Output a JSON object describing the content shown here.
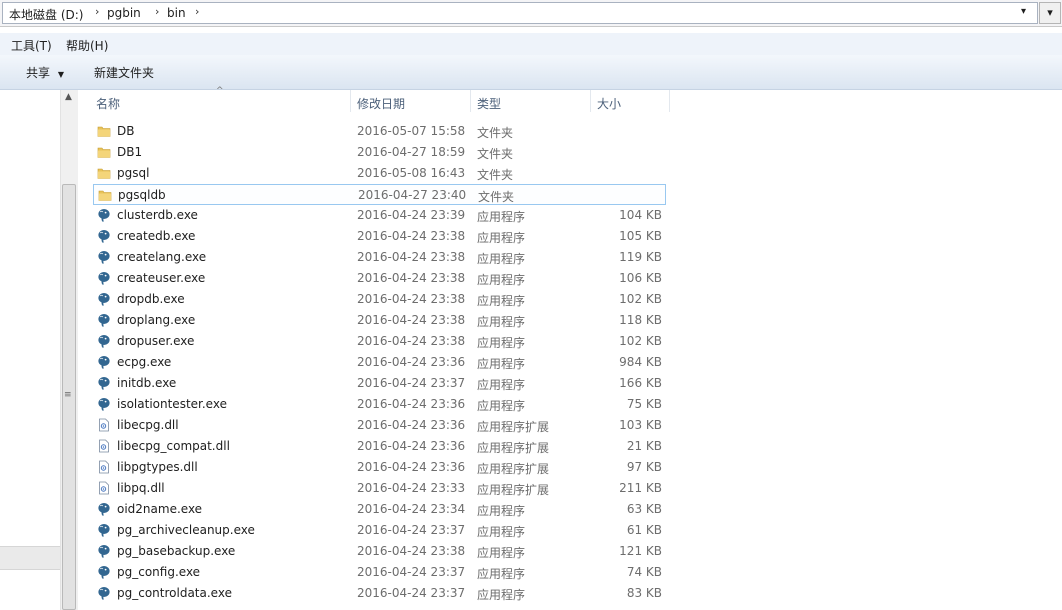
{
  "address": {
    "crumbs": [
      "本地磁盘 (D:)",
      "pgbin",
      "bin"
    ],
    "separator": "›",
    "dropdown": "▾",
    "refresh": "▾"
  },
  "menu": {
    "items": [
      "工具(T)",
      "帮助(H)"
    ]
  },
  "toolbar": {
    "share_label": "共享",
    "share_arrow": "▼",
    "new_folder_label": "新建文件夹"
  },
  "columns": {
    "name": "名称",
    "date": "修改日期",
    "type": "类型",
    "size": "大小"
  },
  "files": [
    {
      "name": "DB",
      "date": "2016-05-07 15:58",
      "type": "文件夹",
      "size": "",
      "icon": "folder-icon"
    },
    {
      "name": "DB1",
      "date": "2016-04-27 18:59",
      "type": "文件夹",
      "size": "",
      "icon": "folder-icon"
    },
    {
      "name": "pgsql",
      "date": "2016-05-08 16:43",
      "type": "文件夹",
      "size": "",
      "icon": "folder-icon"
    },
    {
      "name": "pgsqldb",
      "date": "2016-04-27 23:40",
      "type": "文件夹",
      "size": "",
      "icon": "folder-icon",
      "selected": true
    },
    {
      "name": "clusterdb.exe",
      "date": "2016-04-24 23:39",
      "type": "应用程序",
      "size": "104 KB",
      "icon": "postgresql-elephant-icon"
    },
    {
      "name": "createdb.exe",
      "date": "2016-04-24 23:38",
      "type": "应用程序",
      "size": "105 KB",
      "icon": "postgresql-elephant-icon"
    },
    {
      "name": "createlang.exe",
      "date": "2016-04-24 23:38",
      "type": "应用程序",
      "size": "119 KB",
      "icon": "postgresql-elephant-icon"
    },
    {
      "name": "createuser.exe",
      "date": "2016-04-24 23:38",
      "type": "应用程序",
      "size": "106 KB",
      "icon": "postgresql-elephant-icon"
    },
    {
      "name": "dropdb.exe",
      "date": "2016-04-24 23:38",
      "type": "应用程序",
      "size": "102 KB",
      "icon": "postgresql-elephant-icon"
    },
    {
      "name": "droplang.exe",
      "date": "2016-04-24 23:38",
      "type": "应用程序",
      "size": "118 KB",
      "icon": "postgresql-elephant-icon"
    },
    {
      "name": "dropuser.exe",
      "date": "2016-04-24 23:38",
      "type": "应用程序",
      "size": "102 KB",
      "icon": "postgresql-elephant-icon"
    },
    {
      "name": "ecpg.exe",
      "date": "2016-04-24 23:36",
      "type": "应用程序",
      "size": "984 KB",
      "icon": "postgresql-elephant-icon"
    },
    {
      "name": "initdb.exe",
      "date": "2016-04-24 23:37",
      "type": "应用程序",
      "size": "166 KB",
      "icon": "postgresql-elephant-icon"
    },
    {
      "name": "isolationtester.exe",
      "date": "2016-04-24 23:36",
      "type": "应用程序",
      "size": "75 KB",
      "icon": "postgresql-elephant-icon"
    },
    {
      "name": "libecpg.dll",
      "date": "2016-04-24 23:36",
      "type": "应用程序扩展",
      "size": "103 KB",
      "icon": "dll-file-icon"
    },
    {
      "name": "libecpg_compat.dll",
      "date": "2016-04-24 23:36",
      "type": "应用程序扩展",
      "size": "21 KB",
      "icon": "dll-file-icon"
    },
    {
      "name": "libpgtypes.dll",
      "date": "2016-04-24 23:36",
      "type": "应用程序扩展",
      "size": "97 KB",
      "icon": "dll-file-icon"
    },
    {
      "name": "libpq.dll",
      "date": "2016-04-24 23:33",
      "type": "应用程序扩展",
      "size": "211 KB",
      "icon": "dll-file-icon"
    },
    {
      "name": "oid2name.exe",
      "date": "2016-04-24 23:34",
      "type": "应用程序",
      "size": "63 KB",
      "icon": "postgresql-elephant-icon"
    },
    {
      "name": "pg_archivecleanup.exe",
      "date": "2016-04-24 23:37",
      "type": "应用程序",
      "size": "61 KB",
      "icon": "postgresql-elephant-icon"
    },
    {
      "name": "pg_basebackup.exe",
      "date": "2016-04-24 23:38",
      "type": "应用程序",
      "size": "121 KB",
      "icon": "postgresql-elephant-icon"
    },
    {
      "name": "pg_config.exe",
      "date": "2016-04-24 23:37",
      "type": "应用程序",
      "size": "74 KB",
      "icon": "postgresql-elephant-icon"
    },
    {
      "name": "pg_controldata.exe",
      "date": "2016-04-24 23:37",
      "type": "应用程序",
      "size": "83 KB",
      "icon": "postgresql-elephant-icon"
    }
  ],
  "colors": {
    "folder": "#e8c35a",
    "elephant": "#336791",
    "selection_border": "#99c8f0",
    "toolbar_bg": "#dbe5f1"
  }
}
